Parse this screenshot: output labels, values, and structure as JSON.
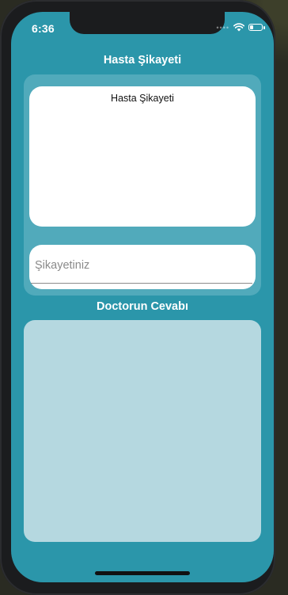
{
  "status_bar": {
    "time": "6:36",
    "signal_dots": "••••",
    "icons": [
      "signal-dots-icon",
      "wifi-icon",
      "battery-icon"
    ],
    "battery_level": 0.3
  },
  "complaint_section": {
    "heading": "Hasta Şikayeti",
    "box_title": "Hasta Şikayeti",
    "input_placeholder": "Şikayetiniz",
    "input_value": ""
  },
  "answer_section": {
    "heading": "Doctorun Cevabı",
    "answer_text": ""
  },
  "colors": {
    "screen_background": "#2b96aa",
    "panel_background": "#51aabb",
    "answer_box_background": "#b5d8e0",
    "card_background": "#ffffff"
  }
}
